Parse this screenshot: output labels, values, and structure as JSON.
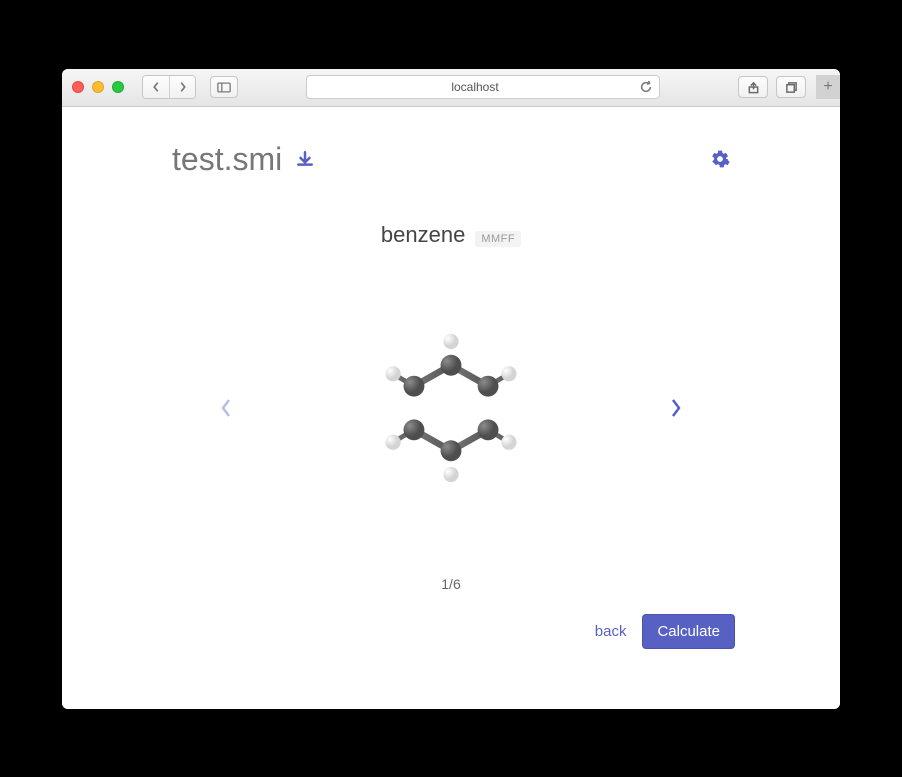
{
  "browser": {
    "url": "localhost"
  },
  "header": {
    "filename": "test.smi"
  },
  "molecule": {
    "name": "benzene",
    "method": "MMFF",
    "current": 1,
    "total": 6,
    "pager_text": "1/6"
  },
  "footer": {
    "back_label": "back",
    "calculate_label": "Calculate"
  }
}
